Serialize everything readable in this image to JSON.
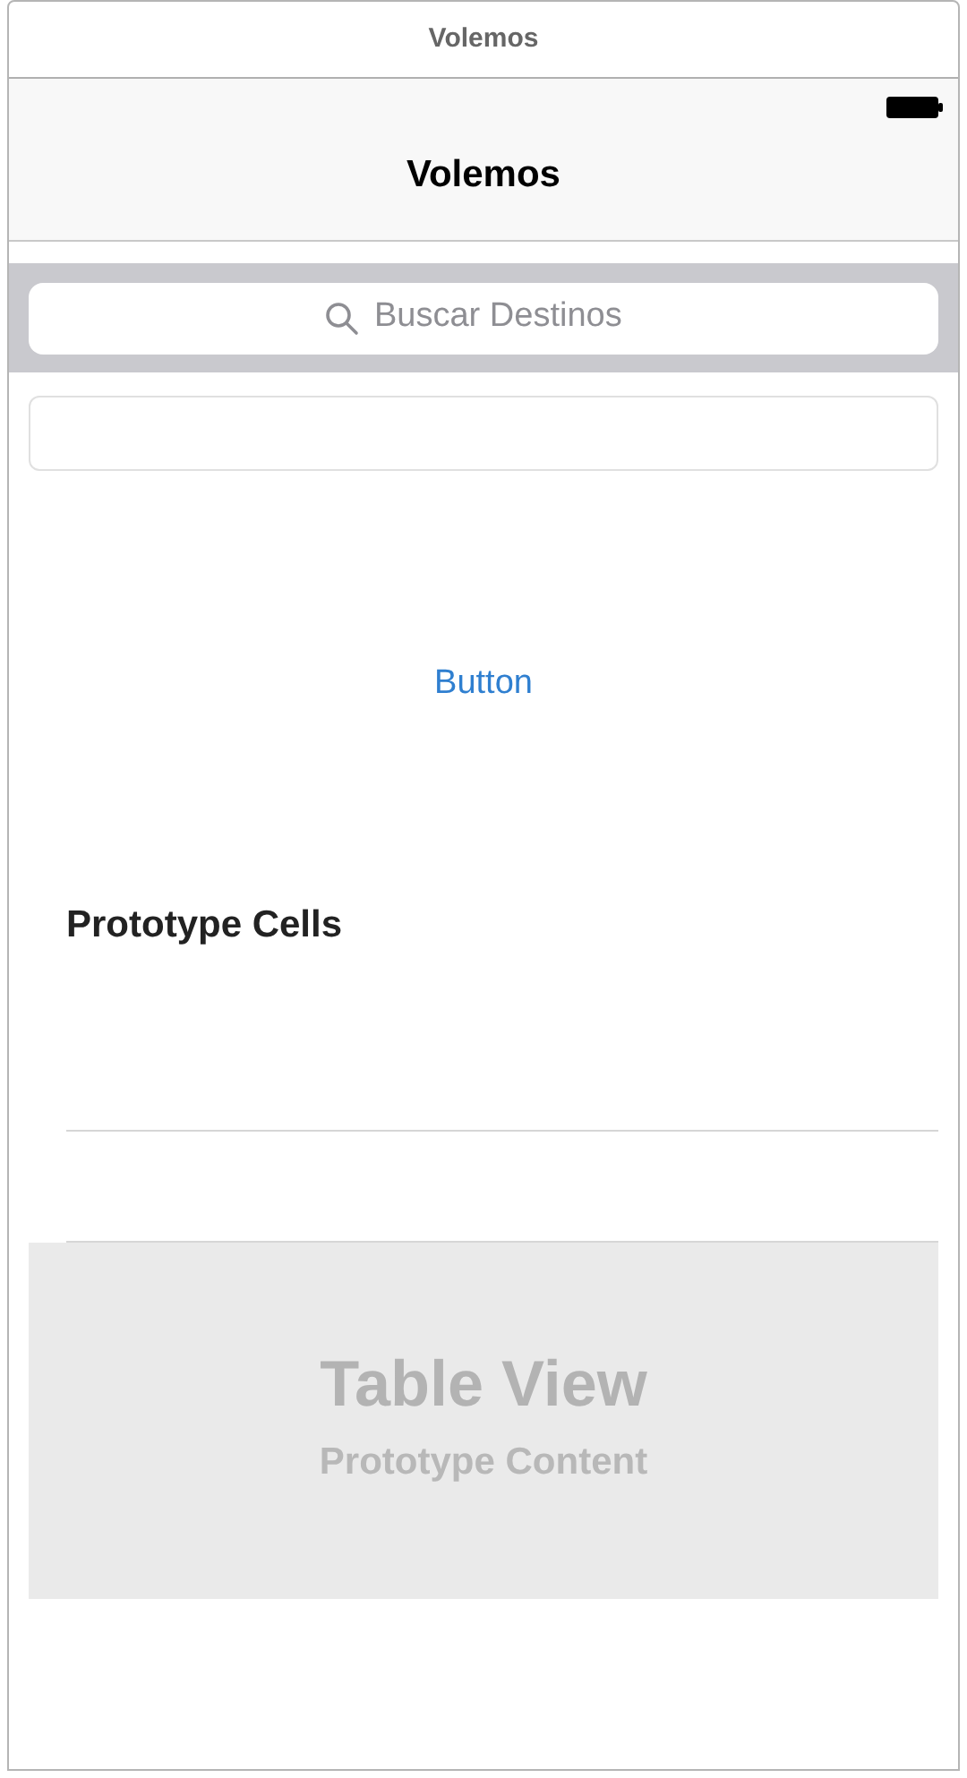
{
  "window": {
    "title": "Volemos"
  },
  "navigation_bar": {
    "title": "Volemos"
  },
  "search_bar": {
    "placeholder": "Buscar Destinos"
  },
  "button": {
    "label": "Button"
  },
  "table": {
    "section_header": "Prototype Cells",
    "placeholder_title": "Table View",
    "placeholder_subtitle": "Prototype Content"
  }
}
